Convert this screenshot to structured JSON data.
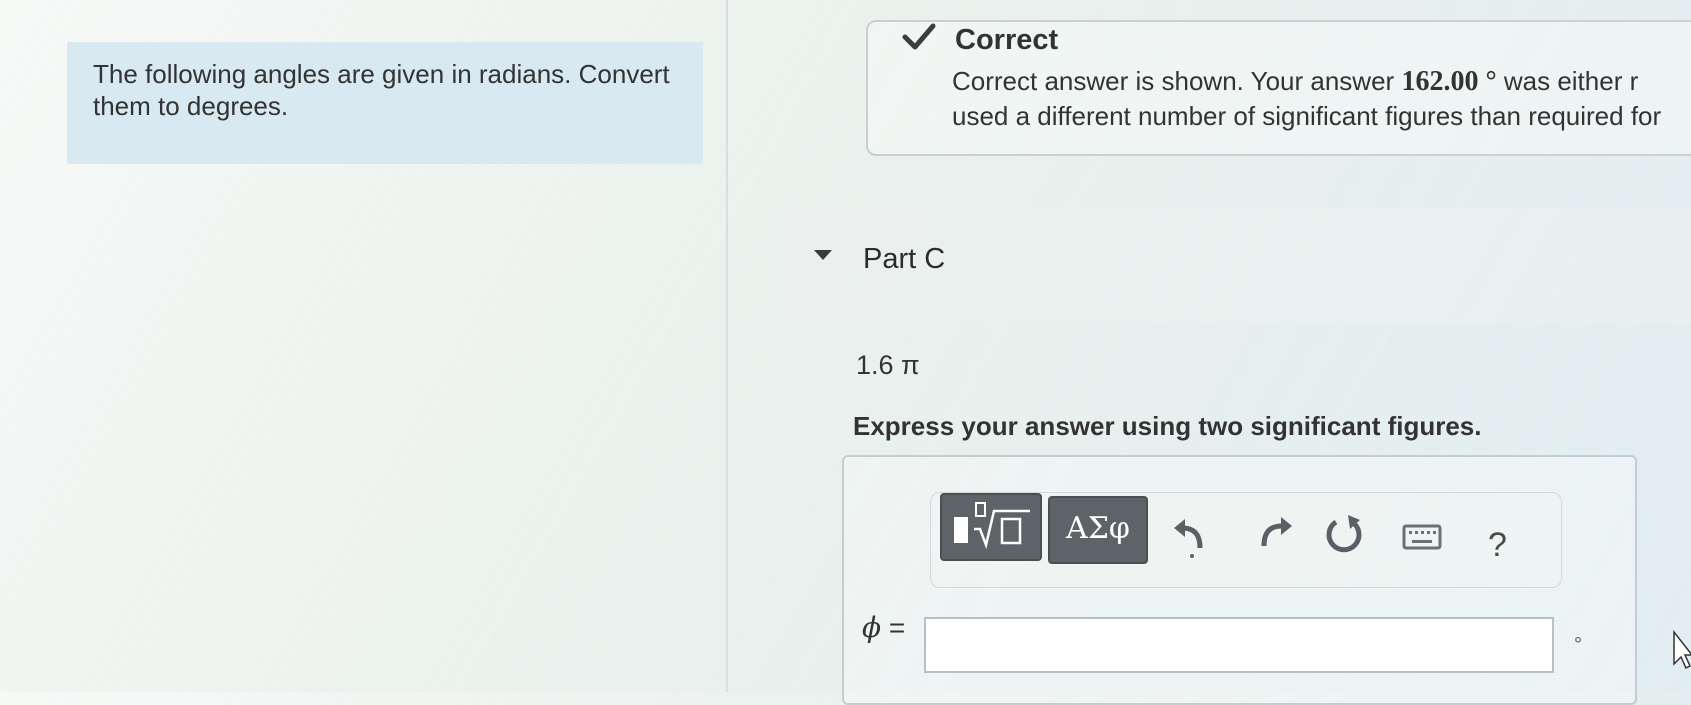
{
  "problem": {
    "intro": "The following angles are given in radians. Convert them to degrees."
  },
  "feedback": {
    "title": "Correct",
    "line1_prefix": "Correct answer is shown. Your answer ",
    "line1_answer": "162.00",
    "line1_unit": " °",
    "line1_suffix": " was either r",
    "line2": "used a different number of significant figures than required for"
  },
  "part": {
    "title": "Part C",
    "value": "1.6 π",
    "instructions": "Express your answer using two significant figures."
  },
  "toolbar": {
    "templates_icon": "templates-radical-icon",
    "symbols_label": "ΑΣφ",
    "undo_icon": "undo-icon",
    "redo_icon": "redo-icon",
    "reset_icon": "reset-icon",
    "keyboard_icon": "keyboard-icon",
    "help_label": "?"
  },
  "answer": {
    "variable": "ϕ",
    "equals": " =",
    "value": "",
    "unit": "°"
  },
  "colors": {
    "intro_background": "#d8e9f2",
    "toolbar_button": "#5e6367",
    "text": "#333333"
  }
}
